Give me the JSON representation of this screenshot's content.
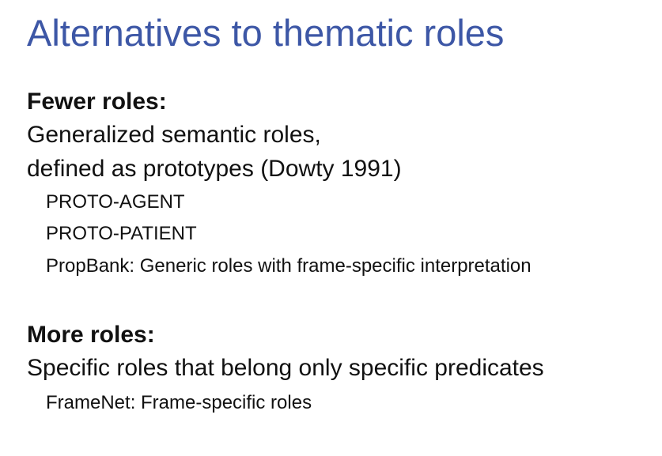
{
  "slide": {
    "title": "Alternatives to thematic roles",
    "fewer": {
      "heading": "Fewer roles:",
      "line1": "Generalized semantic roles,",
      "line2": "defined as prototypes (Dowty 1991)",
      "items": [
        "PROTO-AGENT",
        "PROTO-PATIENT",
        "PropBank: Generic roles with frame-specific interpretation"
      ]
    },
    "more": {
      "heading": "More roles:",
      "line1": "Specific roles that belong only specific predicates",
      "items": [
        "FrameNet: Frame-specific roles"
      ]
    }
  }
}
